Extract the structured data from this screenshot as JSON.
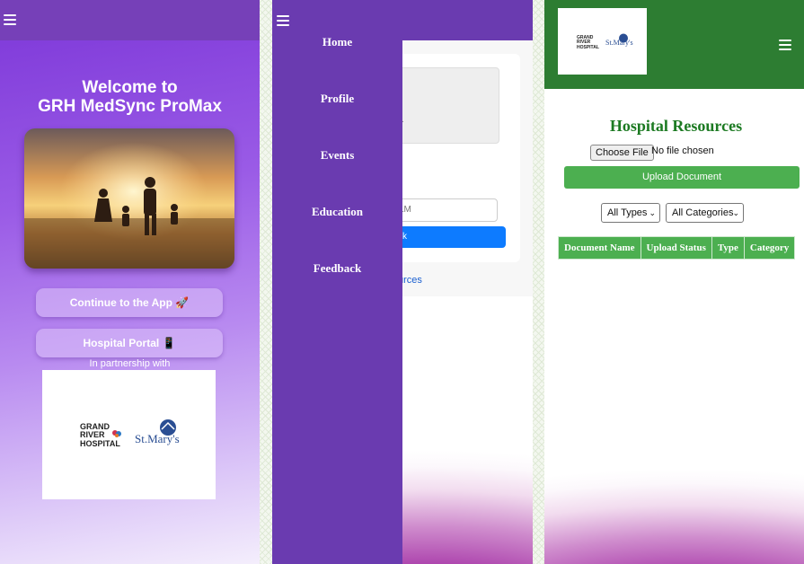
{
  "screen1": {
    "welcome_line1": "Welcome to",
    "welcome_line2": "GRH MedSync ProMax",
    "continue_button": "Continue to the App 🚀",
    "portal_button": "Hospital Portal 📱",
    "partnership_text": "In partnership with",
    "logo_grh": [
      "GRAND",
      "RIVER",
      "HOSPITAL"
    ],
    "logo_stmarys": "St.Mary's"
  },
  "screen2": {
    "menu_items": [
      "Home",
      "Profile",
      "Events",
      "Education",
      "Feedback"
    ],
    "partial_ellipsis": "..",
    "partial_input": "LM",
    "partial_button": "sk",
    "partial_link": "urces"
  },
  "screen3": {
    "logo_grh": [
      "GRAND",
      "RIVER",
      "HOSPITAL"
    ],
    "logo_stmarys": "St.Mary's",
    "title": "Hospital Resources",
    "file_button": "Choose File",
    "file_status": "No file chosen",
    "upload_button": "Upload Document",
    "type_select": "All Types",
    "category_select": "All Categories",
    "table_headers": [
      "Document Name",
      "Upload Status",
      "Type",
      "Category"
    ]
  },
  "colors": {
    "purple_header": "#6a3bb0",
    "green_header": "#2d7d32",
    "green_accent": "#4caf50",
    "blue_button": "#0d7bff"
  }
}
